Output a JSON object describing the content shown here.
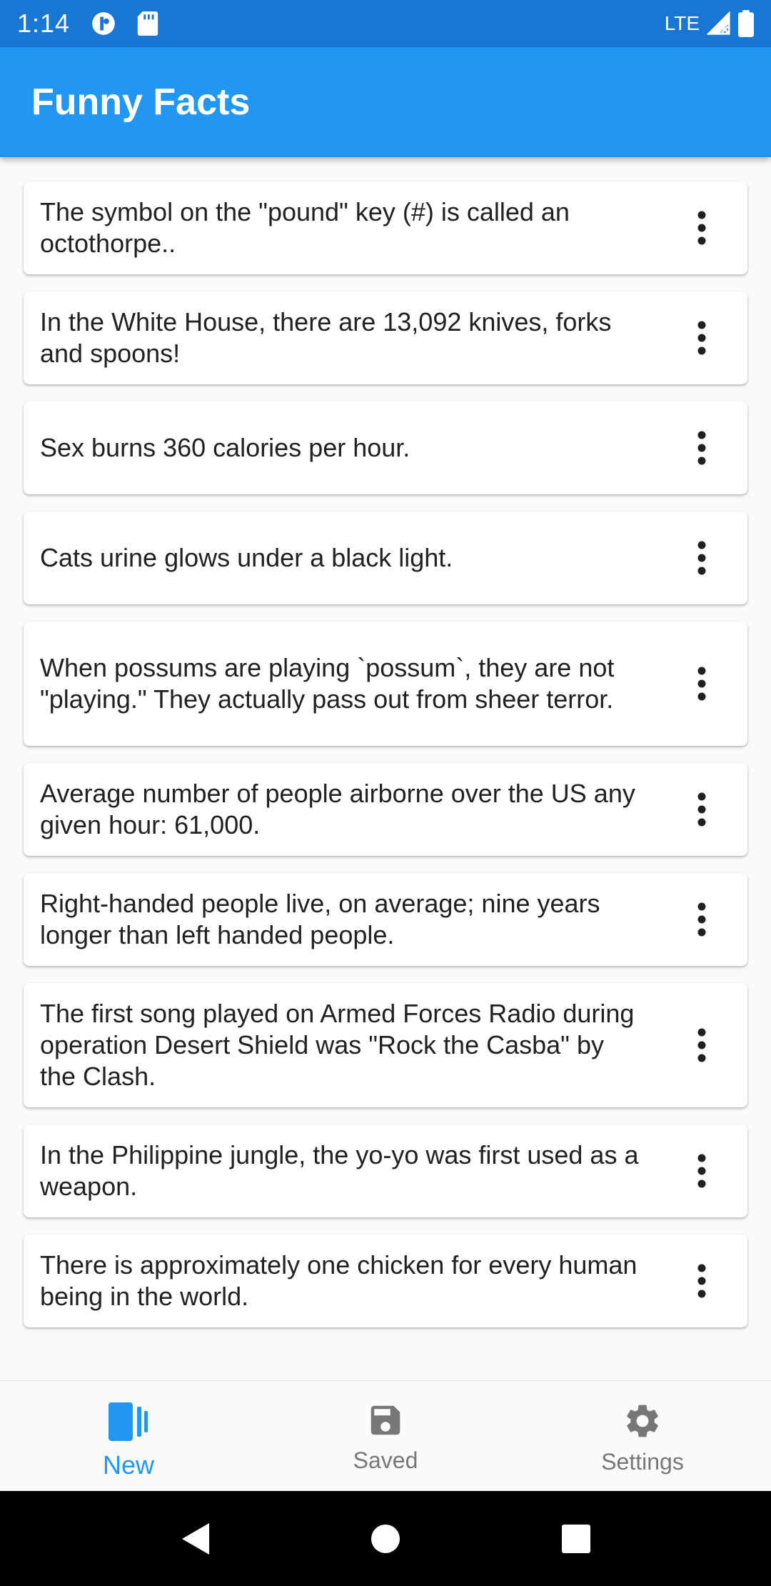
{
  "status_bar": {
    "time": "1:14",
    "network": "LTE",
    "icons": [
      "data-saver-icon",
      "sd-card-icon",
      "signal-icon",
      "battery-icon"
    ]
  },
  "app_bar": {
    "title": "Funny Facts"
  },
  "facts": [
    "The symbol on the \"pound\" key (#) is called an octothorpe..",
    "In the White House, there are 13,092 knives, forks and spoons!",
    "Sex burns 360 calories per hour.",
    "Cats urine glows under a black light.",
    "When possums are playing `possum`, they are not \"playing.\" They actually pass out from sheer terror.",
    "Average number of people airborne over the US any given hour: 61,000.",
    "Right-handed people live, on average; nine years longer than left handed people.",
    "The first song played on Armed Forces Radio during operation Desert Shield was \"Rock the Casba\" by the Clash.",
    "In the Philippine jungle, the yo-yo was first used as a weapon.",
    "There is approximately one chicken for every human being in the world."
  ],
  "bottom_nav": {
    "items": [
      {
        "label": "New",
        "icon": "cards-icon",
        "active": true
      },
      {
        "label": "Saved",
        "icon": "floppy-disk-icon",
        "active": false
      },
      {
        "label": "Settings",
        "icon": "gear-icon",
        "active": false
      }
    ]
  },
  "colors": {
    "status_bar": "#1976d2",
    "app_bar": "#2196f3",
    "accent": "#2196f3",
    "inactive": "#777777"
  },
  "system_nav": {
    "icons": [
      "back-icon",
      "home-icon",
      "recents-icon"
    ]
  }
}
